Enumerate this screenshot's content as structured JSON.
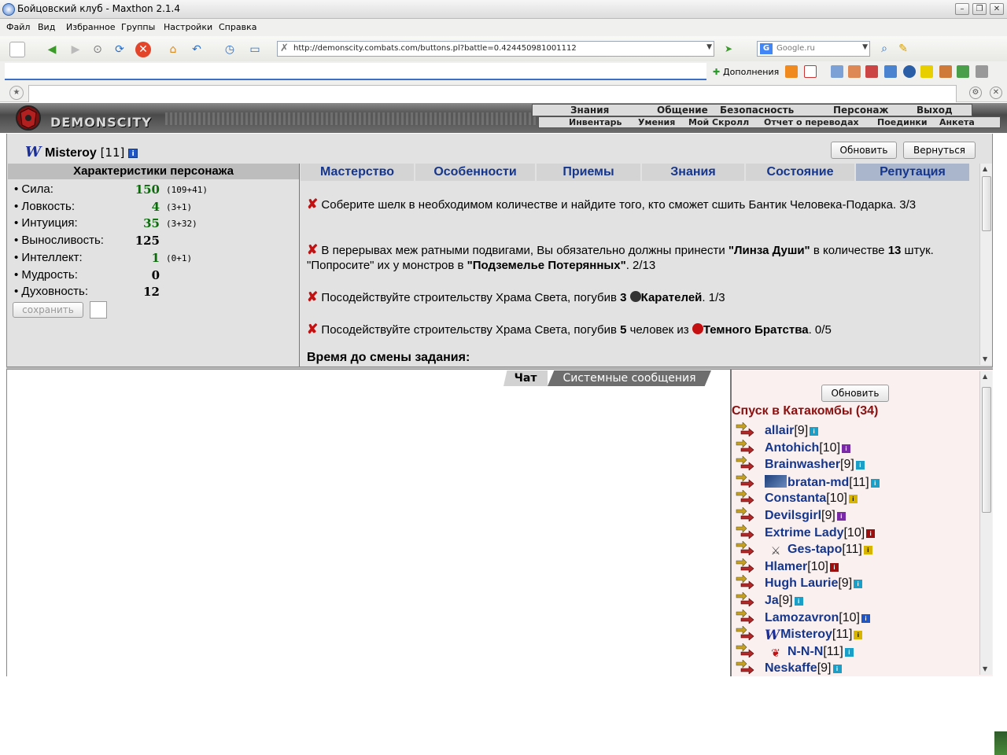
{
  "window": {
    "title": "Бойцовский клуб - Maxthon 2.1.4"
  },
  "menu": [
    "Файл",
    "Вид",
    "Избранное",
    "Группы",
    "Настройки",
    "Справка"
  ],
  "address": {
    "url": "http://demonscity.combats.com/buttons.pl?battle=0.424450981001112"
  },
  "search": {
    "engine": "Google.ru"
  },
  "addons_label": "Дополнения",
  "game": {
    "brand": "DEMONSCITY",
    "topnav": [
      "Знания",
      "Общение",
      "Безопасность",
      "Персонаж",
      "Выход"
    ],
    "subnav": [
      "Инвентарь",
      "Умения",
      "Мой Скролл",
      "Отчет о переводах",
      "Поединки",
      "Анкета"
    ]
  },
  "character": {
    "emblem": "W",
    "name": "Misteroy",
    "level": "[11]",
    "refresh_label": "Обновить",
    "back_label": "Вернуться"
  },
  "stats": {
    "title": "Характеристики персонажа",
    "rows": [
      {
        "label": "• Сила:",
        "value": "150",
        "bonus": "(109+41)",
        "green": true
      },
      {
        "label": "• Ловкость:",
        "value": "4",
        "bonus": "(3+1)",
        "green": true
      },
      {
        "label": "• Интуиция:",
        "value": "35",
        "bonus": "(3+32)",
        "green": true
      },
      {
        "label": "• Выносливость:",
        "value": "125",
        "bonus": "",
        "green": false
      },
      {
        "label": "• Интеллект:",
        "value": "1",
        "bonus": "(0+1)",
        "green": true
      },
      {
        "label": "• Мудрость:",
        "value": "0",
        "bonus": "",
        "green": false
      },
      {
        "label": "• Духовность:",
        "value": "12",
        "bonus": "",
        "green": false
      }
    ],
    "save_label": "сохранить"
  },
  "tabs": [
    "Мастерство",
    "Особенности",
    "Приемы",
    "Знания",
    "Состояние",
    "Репутация"
  ],
  "active_tab": "Репутация",
  "quests": {
    "q1": {
      "text": "Соберите шелк в необходимом количестве и найдите того, кто сможет сшить Бантик Человека-Подарка. 3/3"
    },
    "q2": {
      "a": "В перерывах меж ратными подвигами, Вы обязательно должны принести ",
      "item": "\"Линза Души\"",
      "b": " в количестве ",
      "count": "13",
      "c": " штук. \"Попросите\" их у монстров в ",
      "place": "\"Подземелье Потерянных\"",
      "d": ". 2/13"
    },
    "q3": {
      "a": "Посодействуйте строительству Храма Света, погубив ",
      "count": "3",
      "target": "Карателей",
      "b": ". 1/3"
    },
    "q4": {
      "a": "Посодействуйте строительству Храма Света, погубив ",
      "count": "5",
      "b": " человек из ",
      "target": "Темного Братства",
      "c": ". 0/5"
    },
    "timer_label": "Время до смены задания:"
  },
  "chat": {
    "tab_chat": "Чат",
    "tab_system": "Системные сообщения"
  },
  "room": {
    "refresh_label": "Обновить",
    "title": "Спуск в Катакомбы (34)",
    "users": [
      {
        "name": "allair",
        "level": "[9]",
        "info": "cyan",
        "emblem": ""
      },
      {
        "name": "Antohich",
        "level": "[10]",
        "info": "purple",
        "emblem": ""
      },
      {
        "name": "Brainwasher",
        "level": "[9]",
        "info": "cyan",
        "emblem": ""
      },
      {
        "name": "bratan-md",
        "level": "[11]",
        "info": "cyan",
        "emblem": "gun"
      },
      {
        "name": "Constanta",
        "level": "[10]",
        "info": "gold",
        "emblem": ""
      },
      {
        "name": "Devilsgirl",
        "level": "[9]",
        "info": "purple",
        "emblem": ""
      },
      {
        "name": "Extrime Lady",
        "level": "[10]",
        "info": "red",
        "emblem": ""
      },
      {
        "name": "Ges-tapo",
        "level": "[11]",
        "info": "gold",
        "emblem": "swords"
      },
      {
        "name": "Hlamer",
        "level": "[10]",
        "info": "red",
        "emblem": ""
      },
      {
        "name": "Hugh Laurie",
        "level": "[9]",
        "info": "cyan",
        "emblem": ""
      },
      {
        "name": "Ja",
        "level": "[9]",
        "info": "cyan",
        "emblem": ""
      },
      {
        "name": "Lamozavron",
        "level": "[10]",
        "info": "blue",
        "emblem": ""
      },
      {
        "name": "Misteroy",
        "level": "[11]",
        "info": "gold",
        "emblem": "W"
      },
      {
        "name": "N-N-N",
        "level": "[11]",
        "info": "cyan",
        "emblem": "wings"
      },
      {
        "name": "Neskaffe",
        "level": "[9]",
        "info": "cyan",
        "emblem": ""
      }
    ]
  }
}
